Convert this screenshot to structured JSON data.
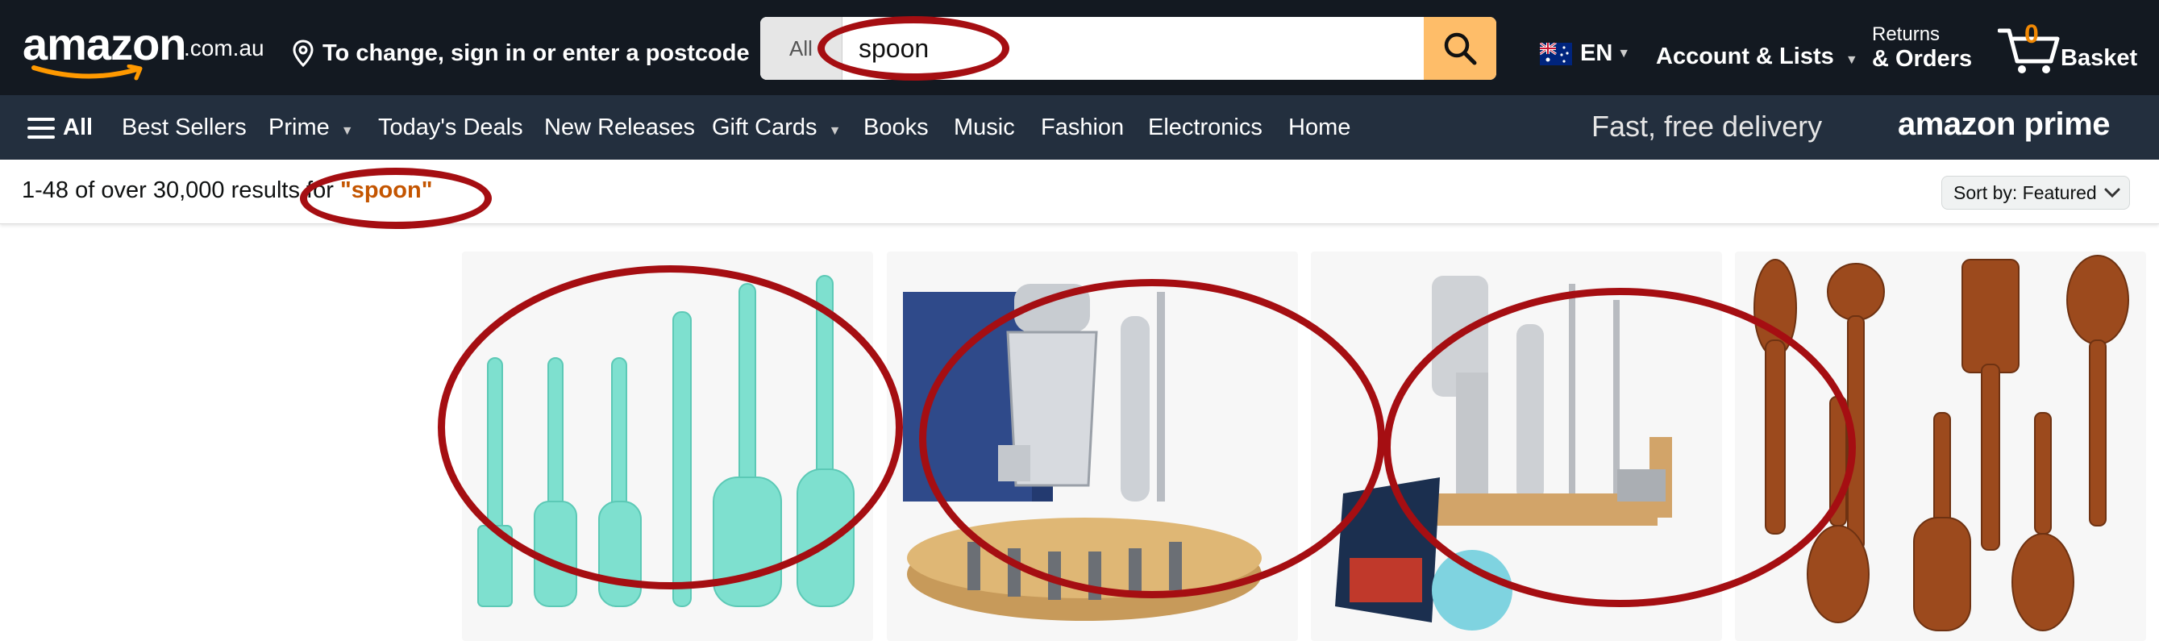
{
  "header": {
    "logo_text": "amazon",
    "logo_tld": ".com.au",
    "deliver_text": "To change, sign in or enter a postcode",
    "search": {
      "category": "All",
      "query": "spoon"
    },
    "language": "EN",
    "account_label": "Account & Lists",
    "returns_line1": "Returns",
    "returns_line2": "& Orders",
    "basket_count": "0",
    "basket_label": "Basket"
  },
  "nav": {
    "all_label": "All",
    "items": [
      "Best Sellers",
      "Prime",
      "Today's Deals",
      "New Releases",
      "Gift Cards",
      "Books",
      "Music",
      "Fashion",
      "Electronics",
      "Home"
    ],
    "promo": "Fast, free delivery",
    "prime_logo": "amazon prime"
  },
  "results": {
    "summary_prefix": "1-48 of over 30,000 results for ",
    "query_quoted": "\"spoon\"",
    "sort_label": "Sort by:",
    "sort_value": "Featured"
  },
  "products": [
    {
      "image": "teal-silicone-spatula-set-icon"
    },
    {
      "image": "cocktail-shaker-bar-set-icon"
    },
    {
      "image": "bar-tool-kit-with-recipe-book-icon"
    },
    {
      "image": "wooden-spoon-utensil-set-icon"
    }
  ],
  "colors": {
    "header_bg": "#131921",
    "nav_bg": "#232f3e",
    "search_button": "#febd69",
    "query_highlight": "#c45500",
    "annotation_ring": "#a50e12",
    "basket_count": "#f08804"
  }
}
